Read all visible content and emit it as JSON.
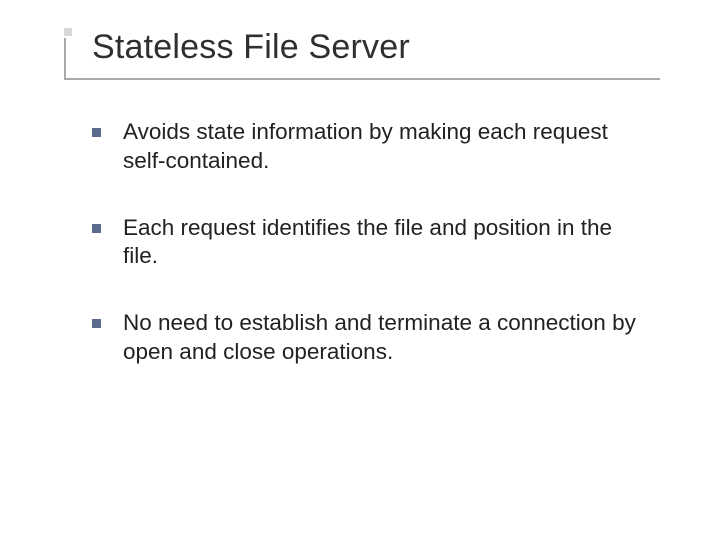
{
  "slide": {
    "title": "Stateless File Server",
    "bullets": [
      {
        "text": "Avoids state information by making each request self-contained."
      },
      {
        "text": "Each request identifies the file and position in the file."
      },
      {
        "text": "No need to establish and terminate a connection by open and close operations."
      }
    ]
  }
}
